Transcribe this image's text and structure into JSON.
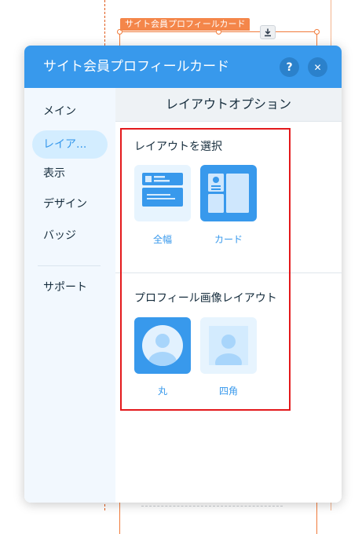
{
  "canvas": {
    "element_tag": "サイト会員プロフィールカード",
    "download_icon": "download-icon",
    "colors": {
      "selection": "#f07a3a",
      "tag": "#f4864a"
    }
  },
  "panel": {
    "title": "サイト会員プロフィールカード",
    "help_label": "?",
    "close_label": "✕",
    "colors": {
      "header": "#3899ec",
      "accent": "#3899ec",
      "nav_bg": "#f2f8fe",
      "nav_active": "#d3edff"
    }
  },
  "sidebar": {
    "items": [
      {
        "label": "メイン",
        "active": false
      },
      {
        "label": "レイア...",
        "active": true
      },
      {
        "label": "表示",
        "active": false
      },
      {
        "label": "デザイン",
        "active": false
      },
      {
        "label": "バッジ",
        "active": false
      }
    ],
    "support_label": "サポート"
  },
  "content": {
    "header": "レイアウトオプション",
    "layout_section": {
      "title": "レイアウトを選択",
      "options": [
        {
          "label": "全幅",
          "icon": "full-width-layout-icon",
          "selected": false
        },
        {
          "label": "カード",
          "icon": "card-layout-icon",
          "selected": true
        }
      ]
    },
    "image_section": {
      "title": "プロフィール画像レイアウト",
      "options": [
        {
          "label": "丸",
          "icon": "circle-avatar-icon",
          "selected": true
        },
        {
          "label": "四角",
          "icon": "square-avatar-icon",
          "selected": false
        }
      ]
    }
  }
}
